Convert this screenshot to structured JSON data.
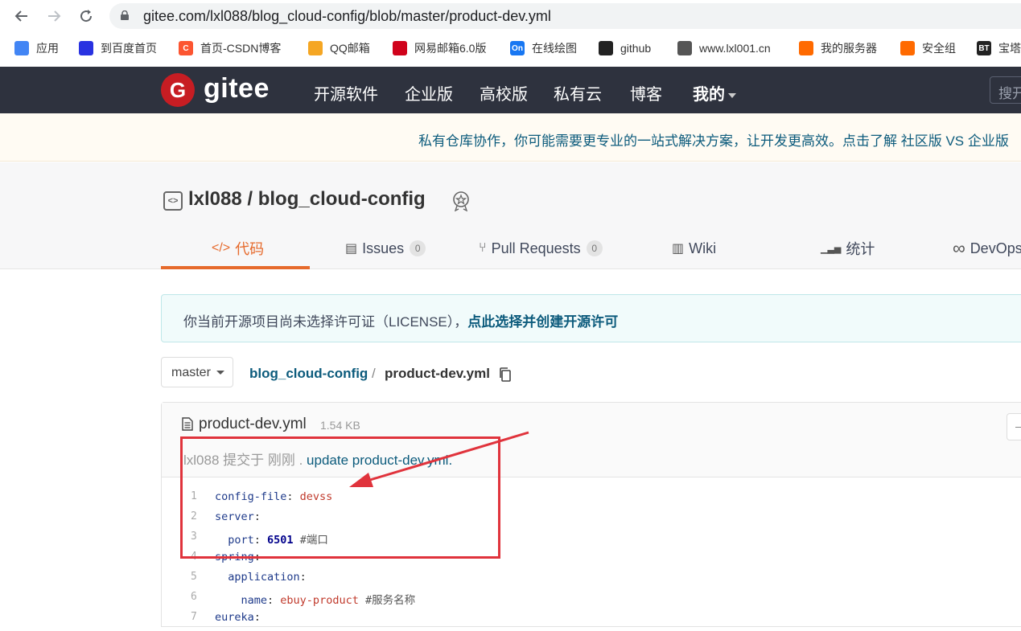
{
  "browser": {
    "url": "gitee.com/lxl088/blog_cloud-config/blob/master/product-dev.yml",
    "bookmarks": [
      {
        "label": "应用",
        "icon": "apps-grid-icon",
        "color": "#4285f4"
      },
      {
        "label": "到百度首页",
        "icon": "baidu-paw-icon",
        "color": "#2932e1"
      },
      {
        "label": "首页-CSDN博客",
        "icon": "csdn-icon",
        "color": "#fc5531"
      },
      {
        "label": "QQ邮箱",
        "icon": "qq-mail-icon",
        "color": "#f5a623"
      },
      {
        "label": "网易邮箱6.0版",
        "icon": "netease-mail-icon",
        "color": "#d0021b"
      },
      {
        "label": "在线绘图",
        "icon": "on-drawing-icon",
        "color": "#1877f2"
      },
      {
        "label": "github",
        "icon": "github-icon",
        "color": "#222222"
      },
      {
        "label": "www.lxl001.cn",
        "icon": "globe-icon",
        "color": "#555555"
      },
      {
        "label": "我的服务器",
        "icon": "aliyun-icon",
        "color": "#ff6a00"
      },
      {
        "label": "安全组",
        "icon": "aliyun-icon",
        "color": "#ff6a00"
      },
      {
        "label": "宝塔",
        "icon": "bt-panel-icon",
        "color": "#222222"
      }
    ],
    "bookmark_ico_texts": [
      "",
      "",
      "C",
      "",
      "",
      "On",
      "",
      "",
      "",
      "",
      "BT"
    ]
  },
  "header": {
    "logo_letter": "G",
    "logo_text": "gitee",
    "nav": [
      "开源软件",
      "企业版",
      "高校版",
      "私有云",
      "博客",
      "我的"
    ],
    "search_placeholder": "搜开"
  },
  "banner": {
    "text": "私有仓库协作，你可能需要更专业的一站式解决方案，让开发更高效。点击了解 社区版 VS 企业版"
  },
  "repo": {
    "title": "lxl088 / blog_cloud-config",
    "tabs": [
      {
        "label": "代码",
        "icon": "</>",
        "count": null
      },
      {
        "label": "Issues",
        "icon": "▤",
        "count": "0"
      },
      {
        "label": "Pull Requests",
        "icon": "⑂",
        "count": "0"
      },
      {
        "label": "Wiki",
        "icon": "▥",
        "count": null
      },
      {
        "label": "统计",
        "icon": "▁▃▅",
        "count": null
      },
      {
        "label": "DevOps",
        "icon": "∞",
        "count": null
      }
    ]
  },
  "license": {
    "text": "你当前开源项目尚未选择许可证（LICENSE），",
    "link": "点此选择并创建开源许可"
  },
  "breadcrumb": {
    "branch": "master",
    "repo": "blog_cloud-config",
    "separator": "/",
    "file": "product-dev.yml"
  },
  "file": {
    "name": "product-dev.yml",
    "size": "1.54 KB",
    "commit_author": "lxl088 提交于 刚刚 .",
    "commit_message": "update product-dev.yml."
  },
  "code_lines": [
    {
      "no": "1",
      "indent": "",
      "key": "config-file",
      "sep": ": ",
      "value": "devss",
      "vtype": "s",
      "comment": ""
    },
    {
      "no": "2",
      "indent": "",
      "key": "server",
      "sep": ":",
      "value": "",
      "vtype": "s",
      "comment": ""
    },
    {
      "no": "3",
      "indent": "  ",
      "key": "port",
      "sep": ": ",
      "value": "6501",
      "vtype": "n",
      "comment": " #端口"
    },
    {
      "no": "4",
      "indent": "",
      "key": "spring",
      "sep": ":",
      "value": "",
      "vtype": "s",
      "comment": ""
    },
    {
      "no": "5",
      "indent": "  ",
      "key": "application",
      "sep": ":",
      "value": "",
      "vtype": "s",
      "comment": ""
    },
    {
      "no": "6",
      "indent": "    ",
      "key": "name",
      "sep": ": ",
      "value": "ebuy-product",
      "vtype": "s",
      "comment": " #服务名称"
    },
    {
      "no": "7",
      "indent": "",
      "key": "eureka",
      "sep": ":",
      "value": "",
      "vtype": "s",
      "comment": ""
    }
  ],
  "colors": {
    "header_bg": "#2e323e",
    "logo_red": "#c71d23",
    "tab_active": "#e66a2c",
    "link": "#0c5b7c",
    "annotation": "#e0333c"
  }
}
